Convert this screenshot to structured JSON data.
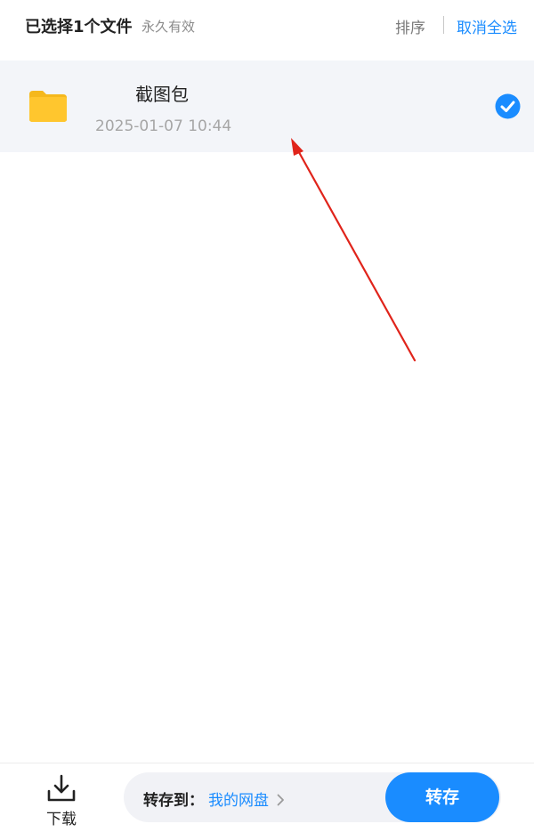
{
  "header": {
    "selected_count_label": "已选择1个文件",
    "validity_label": "永久有效",
    "sort_label": "排序",
    "deselect_all_label": "取消全选"
  },
  "file": {
    "icon": "folder-icon",
    "name": "截图包",
    "date": "2025-01-07 10:44",
    "selected": true
  },
  "bottom_bar": {
    "download_label": "下载",
    "save_to_label": "转存到：",
    "save_target": "我的网盘",
    "save_button_label": "转存"
  },
  "colors": {
    "accent": "#1a8cff",
    "folder": "#ffc62e",
    "annotation_arrow": "#e0241b",
    "row_selected_bg": "#f3f5f9"
  }
}
